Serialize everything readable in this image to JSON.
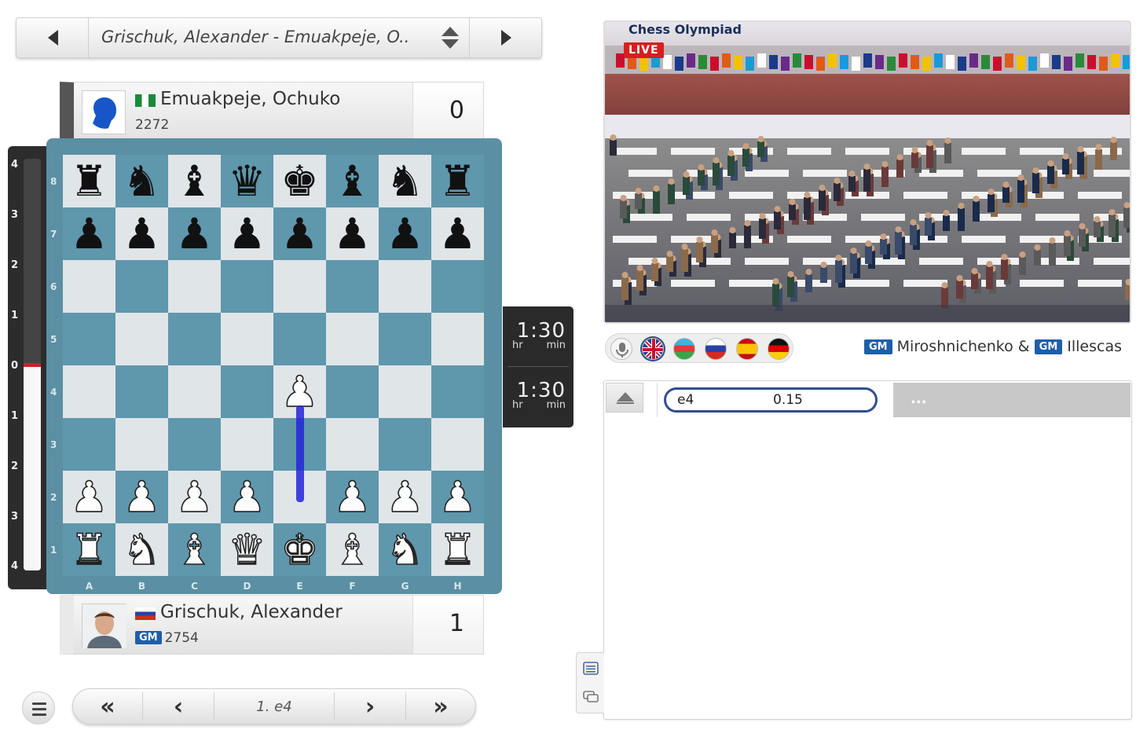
{
  "game_selector": {
    "title": "Grischuk, Alexander - Emuakpeje, O.."
  },
  "top_player": {
    "name": "Emuakpeje, Ochuko",
    "rating": "2272",
    "score": "0",
    "flag": "nigeria",
    "avatar_icon": "placeholder-head-icon"
  },
  "bottom_player": {
    "name": "Grischuk, Alexander",
    "rating": "2754",
    "title": "GM",
    "score": "1",
    "flag": "russia"
  },
  "eval_bar": {
    "labels_top": [
      "4",
      "3",
      "2",
      "1"
    ],
    "label_zero": "0",
    "labels_bottom": [
      "1",
      "2",
      "3",
      "4"
    ],
    "white_fraction": 0.5
  },
  "board": {
    "ranks": [
      "8",
      "7",
      "6",
      "5",
      "4",
      "3",
      "2",
      "1"
    ],
    "files": [
      "A",
      "B",
      "C",
      "D",
      "E",
      "F",
      "G",
      "H"
    ],
    "position": [
      [
        "r",
        "n",
        "b",
        "q",
        "k",
        "b",
        "n",
        "r"
      ],
      [
        "p",
        "p",
        "p",
        "p",
        "p",
        "p",
        "p",
        "p"
      ],
      [
        "",
        "",
        "",
        "",
        "",
        "",
        "",
        ""
      ],
      [
        "",
        "",
        "",
        "",
        "",
        "",
        "",
        ""
      ],
      [
        "",
        "",
        "",
        "",
        "P",
        "",
        "",
        ""
      ],
      [
        "",
        "",
        "",
        "",
        "",
        "",
        "",
        ""
      ],
      [
        "P",
        "P",
        "P",
        "P",
        "",
        "P",
        "P",
        "P"
      ],
      [
        "R",
        "N",
        "B",
        "Q",
        "K",
        "B",
        "N",
        "R"
      ]
    ],
    "last_move": "e2-e4"
  },
  "clocks": {
    "top": {
      "time": "1:30",
      "hr": "hr",
      "min": "min"
    },
    "bottom": {
      "time": "1:30",
      "hr": "hr",
      "min": "min"
    }
  },
  "nav": {
    "first": "«",
    "prev": "‹",
    "move": "1. e4",
    "next": "›",
    "last": "»"
  },
  "video": {
    "live_label": "LIVE",
    "caption": "Chess Olympiad"
  },
  "commentary": {
    "languages": [
      "microphone",
      "english",
      "azerbaijani",
      "russian",
      "spanish",
      "german"
    ],
    "selected": "english",
    "commentator1_title": "GM",
    "commentator1": "Miroshnichenko",
    "separator": "&",
    "commentator2_title": "GM",
    "commentator2": "Illescas"
  },
  "analysis": {
    "move": "e4",
    "eval": "0.15",
    "more": "..."
  },
  "colors": {
    "dark_square": "#5f97ad",
    "light_square": "#e0e5e8",
    "gm_badge": "#1f5ea8",
    "live": "#d81e1e",
    "arrow": "#2323d8"
  }
}
